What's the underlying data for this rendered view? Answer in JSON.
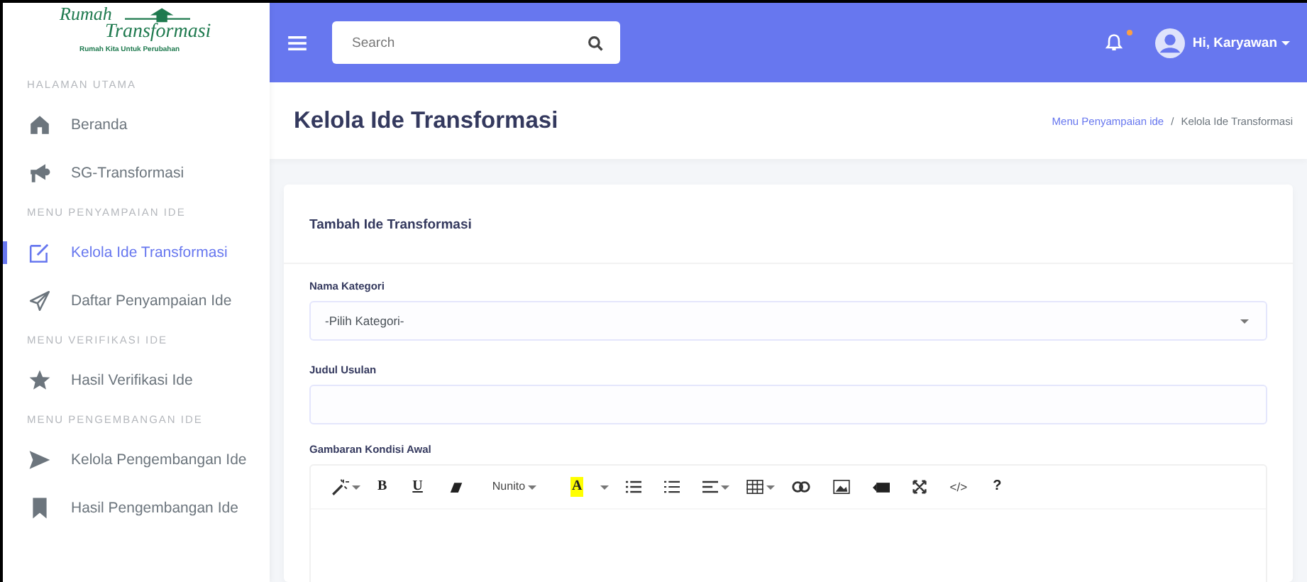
{
  "logo": {
    "line_1": "Rumah",
    "line_2": "Transformasi",
    "tagline": "Rumah Kita Untuk Perubahan"
  },
  "sidebar": {
    "sections": [
      {
        "heading": "HALAMAN UTAMA",
        "items": [
          {
            "label": "Beranda",
            "selected": false
          },
          {
            "label": "SG-Transformasi",
            "selected": false
          }
        ]
      },
      {
        "heading": "MENU PENYAMPAIAN IDE",
        "items": [
          {
            "label": "Kelola Ide Transformasi",
            "selected": true
          },
          {
            "label": "Daftar Penyampaian Ide",
            "selected": false
          }
        ]
      },
      {
        "heading": "MENU VERIFIKASI IDE",
        "items": [
          {
            "label": "Hasil Verifikasi Ide",
            "selected": false
          }
        ]
      },
      {
        "heading": "MENU PENGEMBANGAN IDE",
        "items": [
          {
            "label": "Kelola Pengembangan Ide",
            "selected": false
          },
          {
            "label": "Hasil Pengembangan Ide",
            "selected": false
          }
        ]
      }
    ]
  },
  "topbar": {
    "search": {
      "placeholder": "Search"
    },
    "notification": {
      "unread": true
    },
    "user": {
      "greeting": "Hi, Karyawan"
    }
  },
  "page": {
    "title": "Kelola Ide Transformasi",
    "breadcrumb": [
      "Menu Penyampaian ide",
      "Kelola Ide Transformasi"
    ],
    "breadcrumb_separator": "/"
  },
  "card": {
    "title": "Tambah Ide Transformasi",
    "fields": [
      {
        "kind": "select",
        "label": "Nama Kategori",
        "value": "-Pilih Kategori-"
      },
      {
        "kind": "text",
        "label": "Judul Usulan"
      },
      {
        "kind": "editor",
        "label": "Gambaran Kondisi Awal"
      }
    ],
    "editor_toolbar": {
      "bold": "B",
      "underline": "U",
      "font": "Nunito",
      "highlight": "A",
      "code": "</>",
      "help": "?"
    }
  }
}
